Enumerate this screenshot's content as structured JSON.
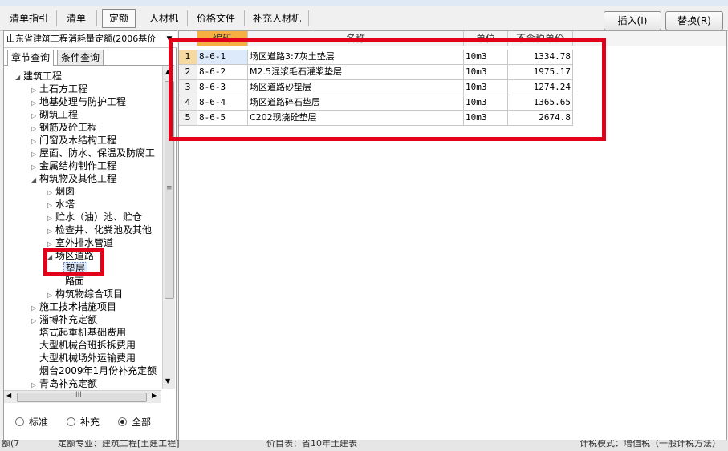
{
  "toolbar": {
    "tabs": [
      "清单指引",
      "清单",
      "定额",
      "人材机",
      "价格文件",
      "补充人材机"
    ],
    "active_tab": "定额",
    "insert_button": "插入(I)",
    "replace_button": "替换(R)"
  },
  "left_panel": {
    "quota_library": "山东省建筑工程消耗量定额(2006基价",
    "subtabs": [
      "章节查询",
      "条件查询"
    ],
    "tree": [
      {
        "label": "建筑工程"
      },
      {
        "label": "土石方工程"
      },
      {
        "label": "地基处理与防护工程"
      },
      {
        "label": "砌筑工程"
      },
      {
        "label": "钢筋及砼工程"
      },
      {
        "label": "门窗及木结构工程"
      },
      {
        "label": "屋面、防水、保温及防腐工"
      },
      {
        "label": "金属结构制作工程"
      },
      {
        "label": "构筑物及其他工程"
      },
      {
        "label": "烟囱"
      },
      {
        "label": "水塔"
      },
      {
        "label": "贮水（油）池、贮仓"
      },
      {
        "label": "检查井、化粪池及其他"
      },
      {
        "label": "室外排水管道"
      },
      {
        "label": "场区道路"
      },
      {
        "label": "垫层"
      },
      {
        "label": "路面"
      },
      {
        "label": "构筑物综合项目"
      },
      {
        "label": "施工技术措施项目"
      },
      {
        "label": "淄博补充定额"
      },
      {
        "label": "塔式起重机基础费用"
      },
      {
        "label": "大型机械台班拆拆费用"
      },
      {
        "label": "大型机械场外运输费用"
      },
      {
        "label": "烟台2009年1月份补充定额"
      },
      {
        "label": "青岛补充定额"
      }
    ],
    "radio_options": [
      "标准",
      "补充",
      "全部"
    ],
    "radio_selected": "全部",
    "hscroll_thumb": "III",
    "vscroll_thumb": "≡"
  },
  "table": {
    "headers": [
      "编码",
      "名称",
      "单位",
      "不含税单价"
    ],
    "rows": [
      {
        "num": "1",
        "code": "8-6-1",
        "name": "场区道路3:7灰土垫层",
        "unit": "10m3",
        "price": "1334.78"
      },
      {
        "num": "2",
        "code": "8-6-2",
        "name": "M2.5混浆毛石灌浆垫层",
        "unit": "10m3",
        "price": "1975.17"
      },
      {
        "num": "3",
        "code": "8-6-3",
        "name": "场区道路砂垫层",
        "unit": "10m3",
        "price": "1274.24"
      },
      {
        "num": "4",
        "code": "8-6-4",
        "name": "场区道路碎石垫层",
        "unit": "10m3",
        "price": "1365.65"
      },
      {
        "num": "5",
        "code": "8-6-5",
        "name": "C202现浇砼垫层",
        "unit": "10m3",
        "price": "2674.8"
      }
    ]
  },
  "status_bar": {
    "left": "额(7",
    "quota_specialty": "定额专业：建筑工程[土建工程]",
    "price_table": "价目表：省10年土建表",
    "tax_mode": "计税模式：增值税（一般计税方法）"
  },
  "colors": {
    "highlight_red": "#e2001a",
    "selected_row": "#dceafc",
    "header_accent": "#f5b041"
  }
}
